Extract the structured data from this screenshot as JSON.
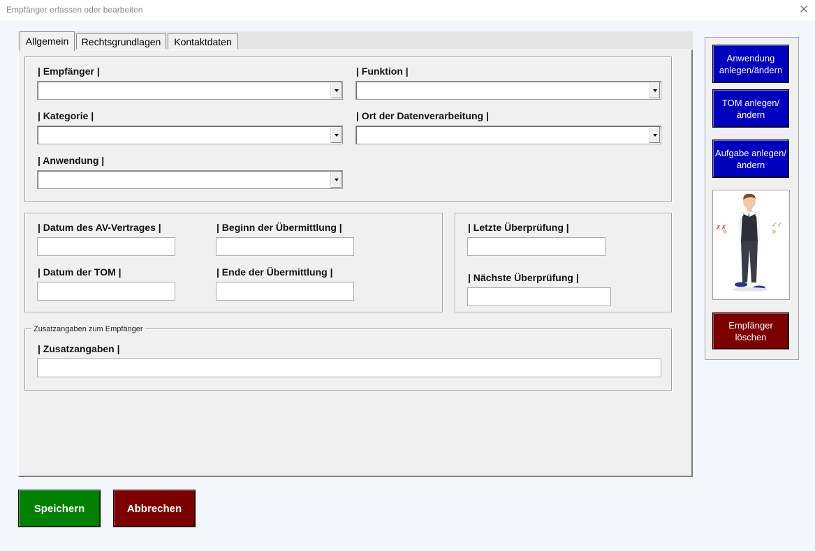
{
  "window": {
    "title": "Empfänger erfassen oder bearbeiten",
    "close_icon": "close-icon"
  },
  "tabs": [
    {
      "label": "Allgemein",
      "active": true
    },
    {
      "label": "Rechtsgrundlagen",
      "active": false
    },
    {
      "label": "Kontaktdaten",
      "active": false
    }
  ],
  "general": {
    "empfaenger": {
      "label": "| Empfänger |",
      "value": ""
    },
    "funktion": {
      "label": "| Funktion |",
      "value": ""
    },
    "kategorie": {
      "label": "| Kategorie |",
      "value": ""
    },
    "ort": {
      "label": "| Ort der Datenverarbeitung |",
      "value": ""
    },
    "anwendung": {
      "label": "| Anwendung |",
      "value": ""
    }
  },
  "dates": {
    "av_vertrag": {
      "label": "| Datum des AV-Vertrages |",
      "value": ""
    },
    "beginn": {
      "label": "| Beginn der Übermittlung |",
      "value": ""
    },
    "tom": {
      "label": "| Datum der TOM |",
      "value": ""
    },
    "ende": {
      "label": "| Ende der Übermittlung |",
      "value": ""
    }
  },
  "review": {
    "letzte": {
      "label": "| Letzte Überprüfung |",
      "value": ""
    },
    "naechste": {
      "label": "| Nächste Überprüfung |",
      "value": ""
    }
  },
  "extra": {
    "frame_caption": "Zusatzangaben zum Empfänger",
    "zusatz": {
      "label": "| Zusatzangaben |",
      "value": ""
    }
  },
  "side": {
    "anwendung_btn": "Anwendung anlegen/ändern",
    "tom_btn": "TOM anlegen/ändern",
    "aufgabe_btn": "Aufgabe anlegen/ändern",
    "loeschen_btn": "Empfänger löschen",
    "illustration_icon": "presenter-man-illustration"
  },
  "footer": {
    "save": "Speichern",
    "cancel": "Abbrechen"
  },
  "colors": {
    "blue": "#0000bf",
    "red": "#7d0000",
    "green": "#008000"
  }
}
